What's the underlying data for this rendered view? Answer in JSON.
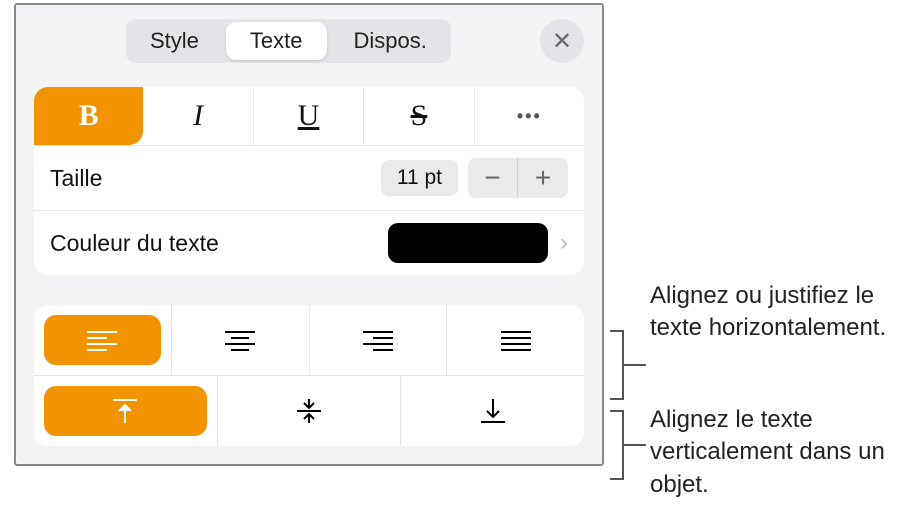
{
  "tabs": {
    "style": "Style",
    "text": "Texte",
    "layout": "Dispos."
  },
  "styleButtons": {
    "bold": "B",
    "italic": "I",
    "underline": "U",
    "strike": "S",
    "more": "•••"
  },
  "size": {
    "label": "Taille",
    "value": "11 pt",
    "minus": "−",
    "plus": "+"
  },
  "textColor": {
    "label": "Couleur du texte",
    "swatch": "#000000"
  },
  "callouts": {
    "horizontal": "Alignez ou justifiez le texte horizontalement.",
    "vertical": "Alignez le texte verticalement dans un objet."
  },
  "colors": {
    "accent": "#f29400"
  }
}
